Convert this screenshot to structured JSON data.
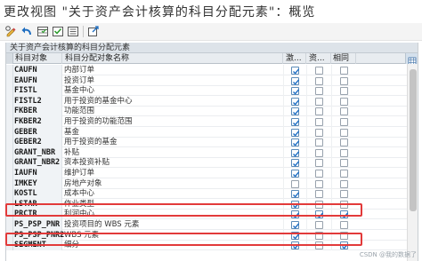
{
  "window": {
    "title": "更改视图 \"关于资产会计核算的科目分配元素\"：概览"
  },
  "toolbar": {
    "icons": [
      "display-change-icon",
      "undo-icon",
      "table-icon",
      "select-all-icon",
      "deselect-icon",
      "export-icon"
    ]
  },
  "table": {
    "caption": "关于资产会计核算的科目分配元素",
    "headers": {
      "code": "科目对象",
      "name": "科目分配对象名称",
      "active": "激...",
      "asset": "资...",
      "same": "相同"
    },
    "rows": [
      {
        "code": "CAUFN",
        "name": "内部订单",
        "active": true,
        "asset": false,
        "same": false
      },
      {
        "code": "EAUFN",
        "name": "投资订单",
        "active": true,
        "asset": false,
        "same": false
      },
      {
        "code": "FISTL",
        "name": "基金中心",
        "active": true,
        "asset": false,
        "same": false
      },
      {
        "code": "FISTL2",
        "name": "用于投资的基金中心",
        "active": true,
        "asset": false,
        "same": false
      },
      {
        "code": "FKBER",
        "name": "功能范围",
        "active": true,
        "asset": false,
        "same": false
      },
      {
        "code": "FKBER2",
        "name": "用于投资的功能范围",
        "active": true,
        "asset": false,
        "same": false
      },
      {
        "code": "GEBER",
        "name": "基金",
        "active": true,
        "asset": false,
        "same": false
      },
      {
        "code": "GEBER2",
        "name": "用于投资的基金",
        "active": true,
        "asset": false,
        "same": false
      },
      {
        "code": "GRANT_NBR",
        "name": "补贴",
        "active": true,
        "asset": false,
        "same": false
      },
      {
        "code": "GRANT_NBR2",
        "name": "资本投资补贴",
        "active": true,
        "asset": false,
        "same": false
      },
      {
        "code": "IAUFN",
        "name": "维护订单",
        "active": true,
        "asset": false,
        "same": false
      },
      {
        "code": "IMKEY",
        "name": "房地产对象",
        "active": false,
        "asset": false,
        "same": false
      },
      {
        "code": "KOSTL",
        "name": "成本中心",
        "active": true,
        "asset": false,
        "same": false
      },
      {
        "code": "LSTAR",
        "name": "作业类型",
        "active": true,
        "asset": false,
        "same": false
      },
      {
        "code": "PRCTR",
        "name": "利润中心",
        "active": true,
        "asset": true,
        "same": true
      },
      {
        "code": "PS_PSP_PNR",
        "name": "投资项目的 WBS 元素",
        "active": true,
        "asset": false,
        "same": false
      },
      {
        "code": "PS_PSP_PNR2",
        "name": "WBS 元素",
        "active": true,
        "asset": false,
        "same": false
      },
      {
        "code": "SEGMENT",
        "name": "细分",
        "active": true,
        "asset": false,
        "same": true
      }
    ]
  },
  "watermark": "CSDN @我的数据了",
  "colors": {
    "highlight": "#e23a3a",
    "check": "#1f6fc5"
  }
}
